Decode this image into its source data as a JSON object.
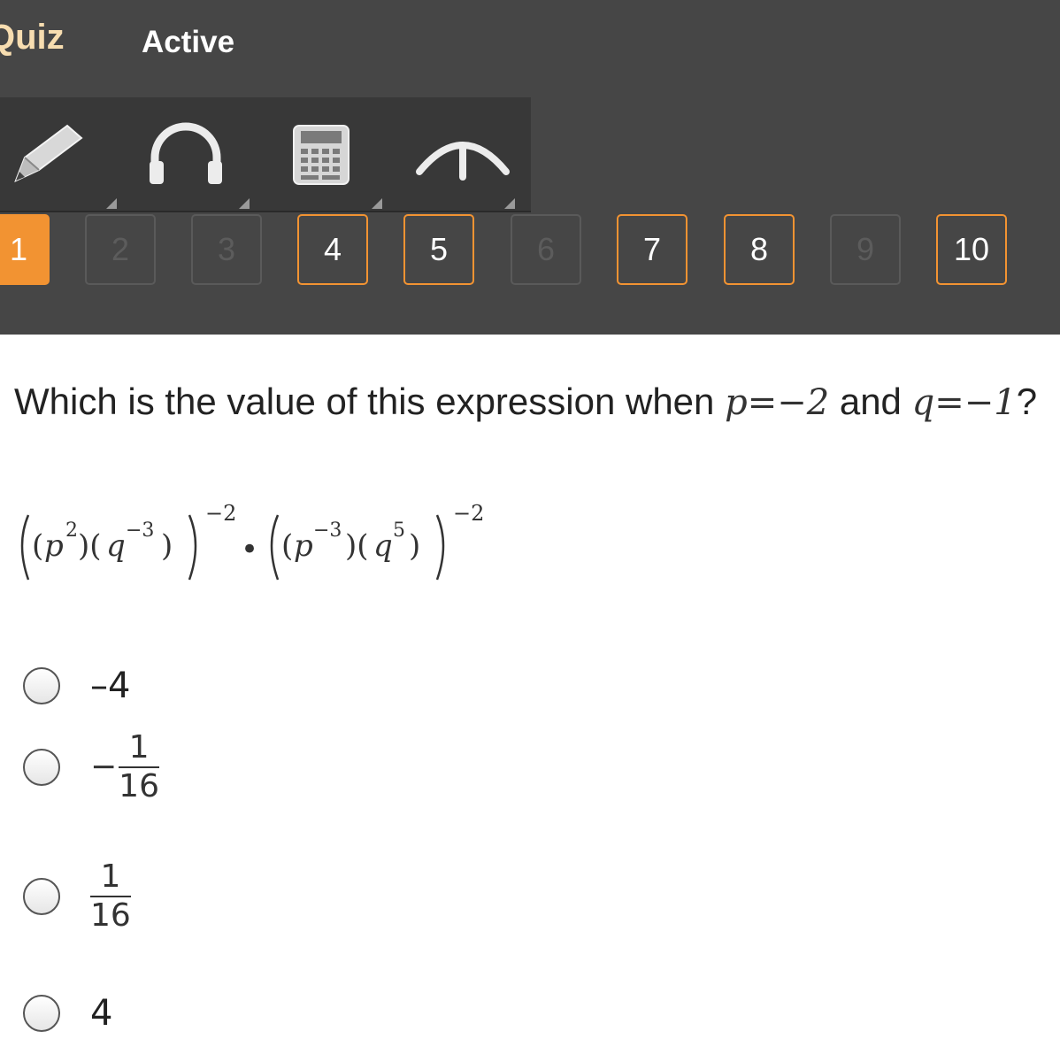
{
  "header": {
    "title": "Quiz",
    "status": "Active"
  },
  "toolbar": {
    "tools": [
      {
        "icon": "pencil-icon"
      },
      {
        "icon": "headphones-icon"
      },
      {
        "icon": "calculator-icon"
      },
      {
        "icon": "collapse-arrow-icon"
      }
    ]
  },
  "question_nav": {
    "items": [
      {
        "label": "1",
        "state": "current"
      },
      {
        "label": "2",
        "state": "disabled"
      },
      {
        "label": "3",
        "state": "disabled"
      },
      {
        "label": "4",
        "state": "visited"
      },
      {
        "label": "5",
        "state": "visited"
      },
      {
        "label": "6",
        "state": "disabled"
      },
      {
        "label": "7",
        "state": "visited"
      },
      {
        "label": "8",
        "state": "visited"
      },
      {
        "label": "9",
        "state": "disabled"
      },
      {
        "label": "10",
        "state": "visited"
      }
    ]
  },
  "question": {
    "prefix": "Which is the value of this expression when ",
    "p_var": "p",
    "p_value": "=−2",
    "conjunction": " and ",
    "q_var": "q",
    "q_value": "=−1",
    "suffix": "?",
    "expression": {
      "outer_exponent": "−2",
      "first_p_exp": "2",
      "first_q_exp": "−3",
      "second_p_exp": "−3",
      "second_q_exp": "5",
      "operator": "•"
    }
  },
  "options": [
    {
      "type": "text",
      "text": "–4"
    },
    {
      "type": "fraction",
      "sign": "−",
      "numerator": "1",
      "denominator": "16"
    },
    {
      "type": "fraction",
      "sign": "",
      "numerator": "1",
      "denominator": "16"
    },
    {
      "type": "text",
      "text": "4"
    }
  ],
  "colors": {
    "header_bg": "#464646",
    "accent": "#f29332",
    "title_color": "#f7ddb0"
  }
}
